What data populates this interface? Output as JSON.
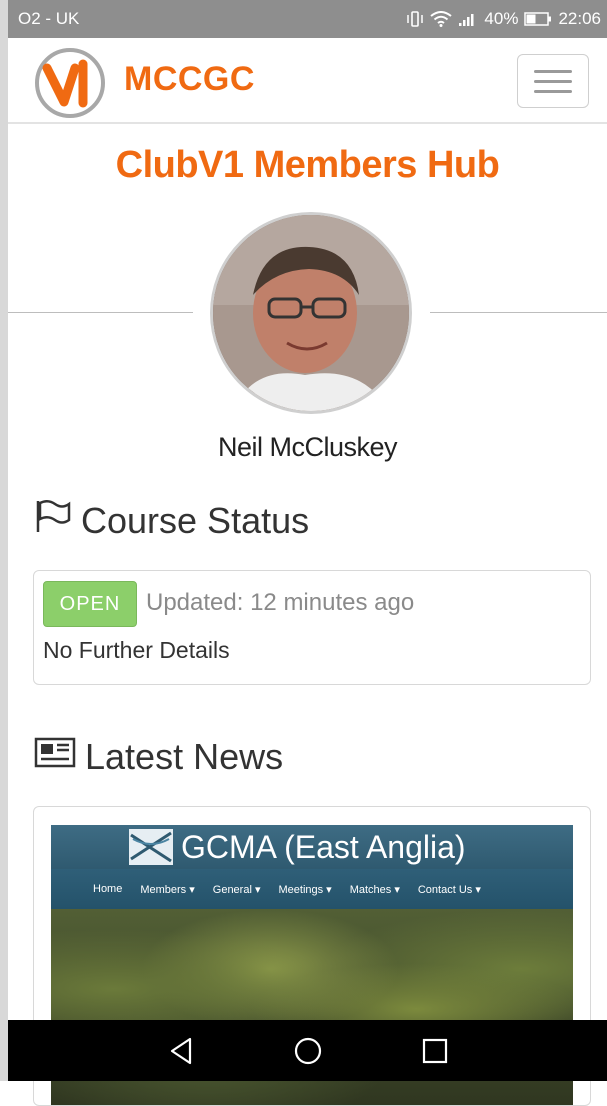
{
  "status_bar": {
    "carrier": "O2 - UK",
    "battery": "40%",
    "time": "22:06"
  },
  "navbar": {
    "brand": "MCCGC",
    "logo_icon": "clubv1-logo-icon",
    "menu_icon": "hamburger-menu-icon"
  },
  "hub": {
    "title": "ClubV1 Members Hub",
    "member_name": "Neil McCluskey",
    "avatar_icon": "member-avatar"
  },
  "course_status": {
    "heading": "Course Status",
    "icon": "flag-icon",
    "badge": "OPEN",
    "updated": "Updated: 12 minutes ago",
    "details": "No Further Details",
    "badge_color": "#8ccf6a"
  },
  "latest_news": {
    "heading": "Latest News",
    "icon": "newspaper-icon",
    "image_title": "GCMA (East Anglia)",
    "image_nav": [
      "Home",
      "Members ▾",
      "General ▾",
      "Meetings ▾",
      "Matches ▾",
      "Contact Us ▾"
    ]
  },
  "bottom_nav": {
    "back_icon": "back-triangle-icon",
    "home_icon": "home-circle-icon",
    "recents_icon": "recents-square-icon"
  },
  "colors": {
    "accent": "#f06a12",
    "status_bar": "#8e8e8e"
  }
}
